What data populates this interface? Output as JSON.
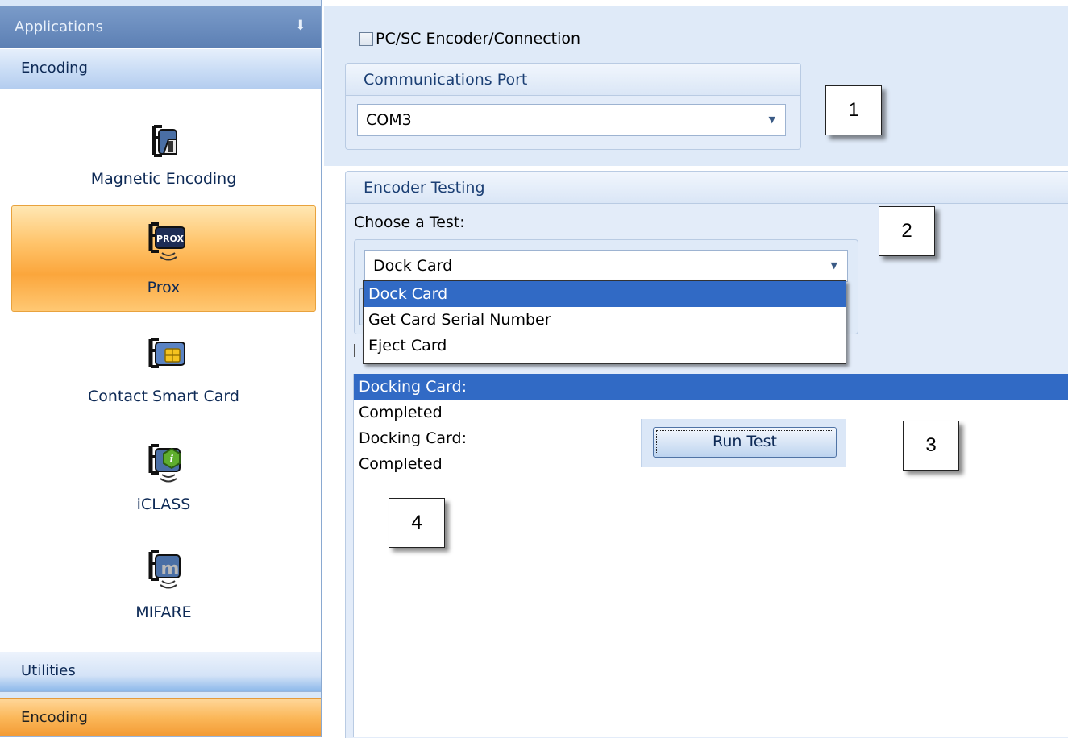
{
  "sidebar": {
    "header": "Applications",
    "group_top": "Encoding",
    "items": [
      {
        "label": "Magnetic Encoding",
        "icon": "magnetic-card-icon"
      },
      {
        "label": "Prox",
        "icon": "prox-card-icon"
      },
      {
        "label": "Contact Smart Card",
        "icon": "smart-card-chip-icon"
      },
      {
        "label": "iCLASS",
        "icon": "iclass-card-icon"
      },
      {
        "label": "MIFARE",
        "icon": "mifare-card-icon"
      }
    ],
    "selected_item": "Prox",
    "group_utilities": "Utilities",
    "group_bottom": "Encoding"
  },
  "main": {
    "pcsc_checkbox_label": "PC/SC Encoder/Connection",
    "pcsc_checked": false,
    "comm_port": {
      "title": "Communications Port",
      "value": "COM3"
    },
    "encoder_testing": {
      "title": "Encoder Testing",
      "choose_label": "Choose a Test:",
      "selected_test": "Dock Card",
      "options": [
        "Dock Card",
        "Get Card Serial Number",
        "Eject Card"
      ],
      "highlighted_option": "Dock Card"
    },
    "run_test_label": "Run Test",
    "results": [
      "Docking Card:",
      "Completed",
      "Docking Card:",
      "Completed"
    ]
  },
  "callouts": [
    "1",
    "2",
    "3",
    "4"
  ],
  "colors": {
    "selection": "#316ac5",
    "selected_nav": "#fba63c",
    "sidebar_header": "#5d80b4"
  }
}
